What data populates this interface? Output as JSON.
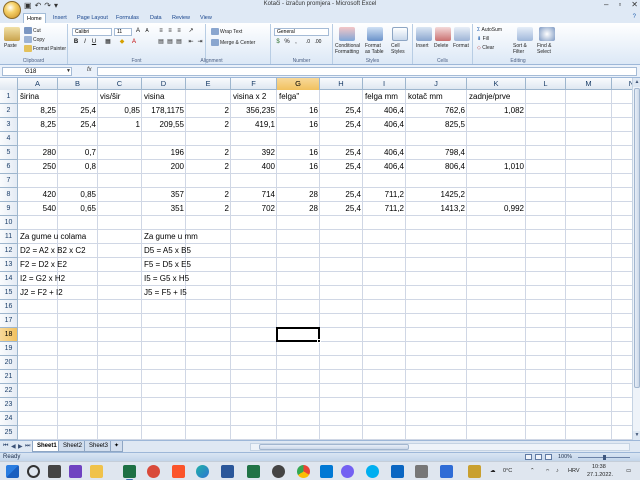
{
  "window": {
    "title": "Kotači - izračun promjera - Microsoft Excel",
    "controls": [
      "–",
      "▫",
      "✕"
    ]
  },
  "tabs": [
    "Home",
    "Insert",
    "Page Layout",
    "Formulas",
    "Data",
    "Review",
    "View"
  ],
  "ribbon": {
    "clipboard": {
      "paste": "Paste",
      "cut": "Cut",
      "copy": "Copy",
      "format_painter": "Format Painter",
      "label": "Clipboard"
    },
    "font": {
      "name": "Calibri",
      "size": "11",
      "label": "Font"
    },
    "alignment": {
      "wrap": "Wrap Text",
      "merge": "Merge & Center",
      "label": "Alignment"
    },
    "number": {
      "format": "General",
      "label": "Number"
    },
    "styles": {
      "conditional": "Conditional Formatting",
      "format_table": "Format as Table",
      "cell_styles": "Cell Styles",
      "label": "Styles"
    },
    "cells": {
      "insert": "Insert",
      "delete": "Delete",
      "format": "Format",
      "label": "Cells"
    },
    "editing": {
      "autosum": "AutoSum",
      "fill": "Fill",
      "clear": "Clear",
      "sort": "Sort & Filter",
      "find": "Find & Select",
      "label": "Editing"
    }
  },
  "formula_bar": {
    "name_box": "G18",
    "fx": "fx",
    "value": ""
  },
  "columns": [
    "A",
    "B",
    "C",
    "D",
    "E",
    "F",
    "G",
    "H",
    "I",
    "J",
    "K",
    "L",
    "M",
    "N"
  ],
  "selected_column": "G",
  "selected_row": "18",
  "rows": [
    "1",
    "2",
    "3",
    "4",
    "5",
    "6",
    "7",
    "8",
    "9",
    "10",
    "11",
    "12",
    "13",
    "14",
    "15",
    "16",
    "17",
    "18",
    "19",
    "20",
    "21",
    "22",
    "23",
    "24",
    "25",
    "26",
    "27"
  ],
  "cells": [
    {
      "ref": "A1",
      "v": "širina",
      "align": "l"
    },
    {
      "ref": "C1",
      "v": "vis/šir",
      "align": "l"
    },
    {
      "ref": "D1",
      "v": "visina",
      "align": "l"
    },
    {
      "ref": "F1",
      "v": "visina x 2",
      "align": "l"
    },
    {
      "ref": "G1",
      "v": "felga\"",
      "align": "l"
    },
    {
      "ref": "I1",
      "v": "felga mm",
      "align": "l"
    },
    {
      "ref": "J1",
      "v": "kotač mm",
      "align": "l"
    },
    {
      "ref": "K1",
      "v": "zadnje/prve",
      "align": "l"
    },
    {
      "ref": "A2",
      "v": "8,25",
      "align": "r"
    },
    {
      "ref": "B2",
      "v": "25,4",
      "align": "r"
    },
    {
      "ref": "C2",
      "v": "0,85",
      "align": "r"
    },
    {
      "ref": "D2",
      "v": "178,1175",
      "align": "r"
    },
    {
      "ref": "E2",
      "v": "2",
      "align": "r"
    },
    {
      "ref": "F2",
      "v": "356,235",
      "align": "r"
    },
    {
      "ref": "G2",
      "v": "16",
      "align": "r"
    },
    {
      "ref": "H2",
      "v": "25,4",
      "align": "r"
    },
    {
      "ref": "I2",
      "v": "406,4",
      "align": "r"
    },
    {
      "ref": "J2",
      "v": "762,6",
      "align": "r"
    },
    {
      "ref": "K2",
      "v": "1,082",
      "align": "r"
    },
    {
      "ref": "A3",
      "v": "8,25",
      "align": "r"
    },
    {
      "ref": "B3",
      "v": "25,4",
      "align": "r"
    },
    {
      "ref": "C3",
      "v": "1",
      "align": "r"
    },
    {
      "ref": "D3",
      "v": "209,55",
      "align": "r"
    },
    {
      "ref": "E3",
      "v": "2",
      "align": "r"
    },
    {
      "ref": "F3",
      "v": "419,1",
      "align": "r"
    },
    {
      "ref": "G3",
      "v": "16",
      "align": "r"
    },
    {
      "ref": "H3",
      "v": "25,4",
      "align": "r"
    },
    {
      "ref": "I3",
      "v": "406,4",
      "align": "r"
    },
    {
      "ref": "J3",
      "v": "825,5",
      "align": "r"
    },
    {
      "ref": "A5",
      "v": "280",
      "align": "r"
    },
    {
      "ref": "B5",
      "v": "0,7",
      "align": "r"
    },
    {
      "ref": "D5",
      "v": "196",
      "align": "r"
    },
    {
      "ref": "E5",
      "v": "2",
      "align": "r"
    },
    {
      "ref": "F5",
      "v": "392",
      "align": "r"
    },
    {
      "ref": "G5",
      "v": "16",
      "align": "r"
    },
    {
      "ref": "H5",
      "v": "25,4",
      "align": "r"
    },
    {
      "ref": "I5",
      "v": "406,4",
      "align": "r"
    },
    {
      "ref": "J5",
      "v": "798,4",
      "align": "r"
    },
    {
      "ref": "A6",
      "v": "250",
      "align": "r"
    },
    {
      "ref": "B6",
      "v": "0,8",
      "align": "r"
    },
    {
      "ref": "D6",
      "v": "200",
      "align": "r"
    },
    {
      "ref": "E6",
      "v": "2",
      "align": "r"
    },
    {
      "ref": "F6",
      "v": "400",
      "align": "r"
    },
    {
      "ref": "G6",
      "v": "16",
      "align": "r"
    },
    {
      "ref": "H6",
      "v": "25,4",
      "align": "r"
    },
    {
      "ref": "I6",
      "v": "406,4",
      "align": "r"
    },
    {
      "ref": "J6",
      "v": "806,4",
      "align": "r"
    },
    {
      "ref": "K6",
      "v": "1,010",
      "align": "r"
    },
    {
      "ref": "A8",
      "v": "420",
      "align": "r"
    },
    {
      "ref": "B8",
      "v": "0,85",
      "align": "r"
    },
    {
      "ref": "D8",
      "v": "357",
      "align": "r"
    },
    {
      "ref": "E8",
      "v": "2",
      "align": "r"
    },
    {
      "ref": "F8",
      "v": "714",
      "align": "r"
    },
    {
      "ref": "G8",
      "v": "28",
      "align": "r"
    },
    {
      "ref": "H8",
      "v": "25,4",
      "align": "r"
    },
    {
      "ref": "I8",
      "v": "711,2",
      "align": "r"
    },
    {
      "ref": "J8",
      "v": "1425,2",
      "align": "r"
    },
    {
      "ref": "A9",
      "v": "540",
      "align": "r"
    },
    {
      "ref": "B9",
      "v": "0,65",
      "align": "r"
    },
    {
      "ref": "D9",
      "v": "351",
      "align": "r"
    },
    {
      "ref": "E9",
      "v": "2",
      "align": "r"
    },
    {
      "ref": "F9",
      "v": "702",
      "align": "r"
    },
    {
      "ref": "G9",
      "v": "28",
      "align": "r"
    },
    {
      "ref": "H9",
      "v": "25,4",
      "align": "r"
    },
    {
      "ref": "I9",
      "v": "711,2",
      "align": "r"
    },
    {
      "ref": "J9",
      "v": "1413,2",
      "align": "r"
    },
    {
      "ref": "K9",
      "v": "0,992",
      "align": "r"
    },
    {
      "ref": "A11",
      "v": "Za gume u colama",
      "align": "l"
    },
    {
      "ref": "D11",
      "v": "Za gume u mm",
      "align": "l"
    },
    {
      "ref": "A12",
      "v": "D2 = A2 x B2 x C2",
      "align": "l"
    },
    {
      "ref": "D12",
      "v": "D5 = A5 x B5",
      "align": "l"
    },
    {
      "ref": "A13",
      "v": "F2 = D2 x E2",
      "align": "l"
    },
    {
      "ref": "D13",
      "v": "F5 = D5 x E5",
      "align": "l"
    },
    {
      "ref": "A14",
      "v": "I2 = G2 x H2",
      "align": "l"
    },
    {
      "ref": "D14",
      "v": "I5 = G5 x H5",
      "align": "l"
    },
    {
      "ref": "A15",
      "v": "J2 = F2 + I2",
      "align": "l"
    },
    {
      "ref": "D15",
      "v": "J5 = F5 + I5",
      "align": "l"
    }
  ],
  "sheets": [
    "Sheet1",
    "Sheet2",
    "Sheet3"
  ],
  "active_sheet": "Sheet1",
  "status": {
    "text": "Ready",
    "zoom": "100%"
  },
  "taskbar": {
    "weather": "0°C",
    "language": "HRV",
    "time": "10:38",
    "date": "27.1.2022."
  },
  "colors": {
    "accent": "#1e5dad",
    "selected_header": "#f1c15f",
    "grid": "#d0d7e5"
  }
}
